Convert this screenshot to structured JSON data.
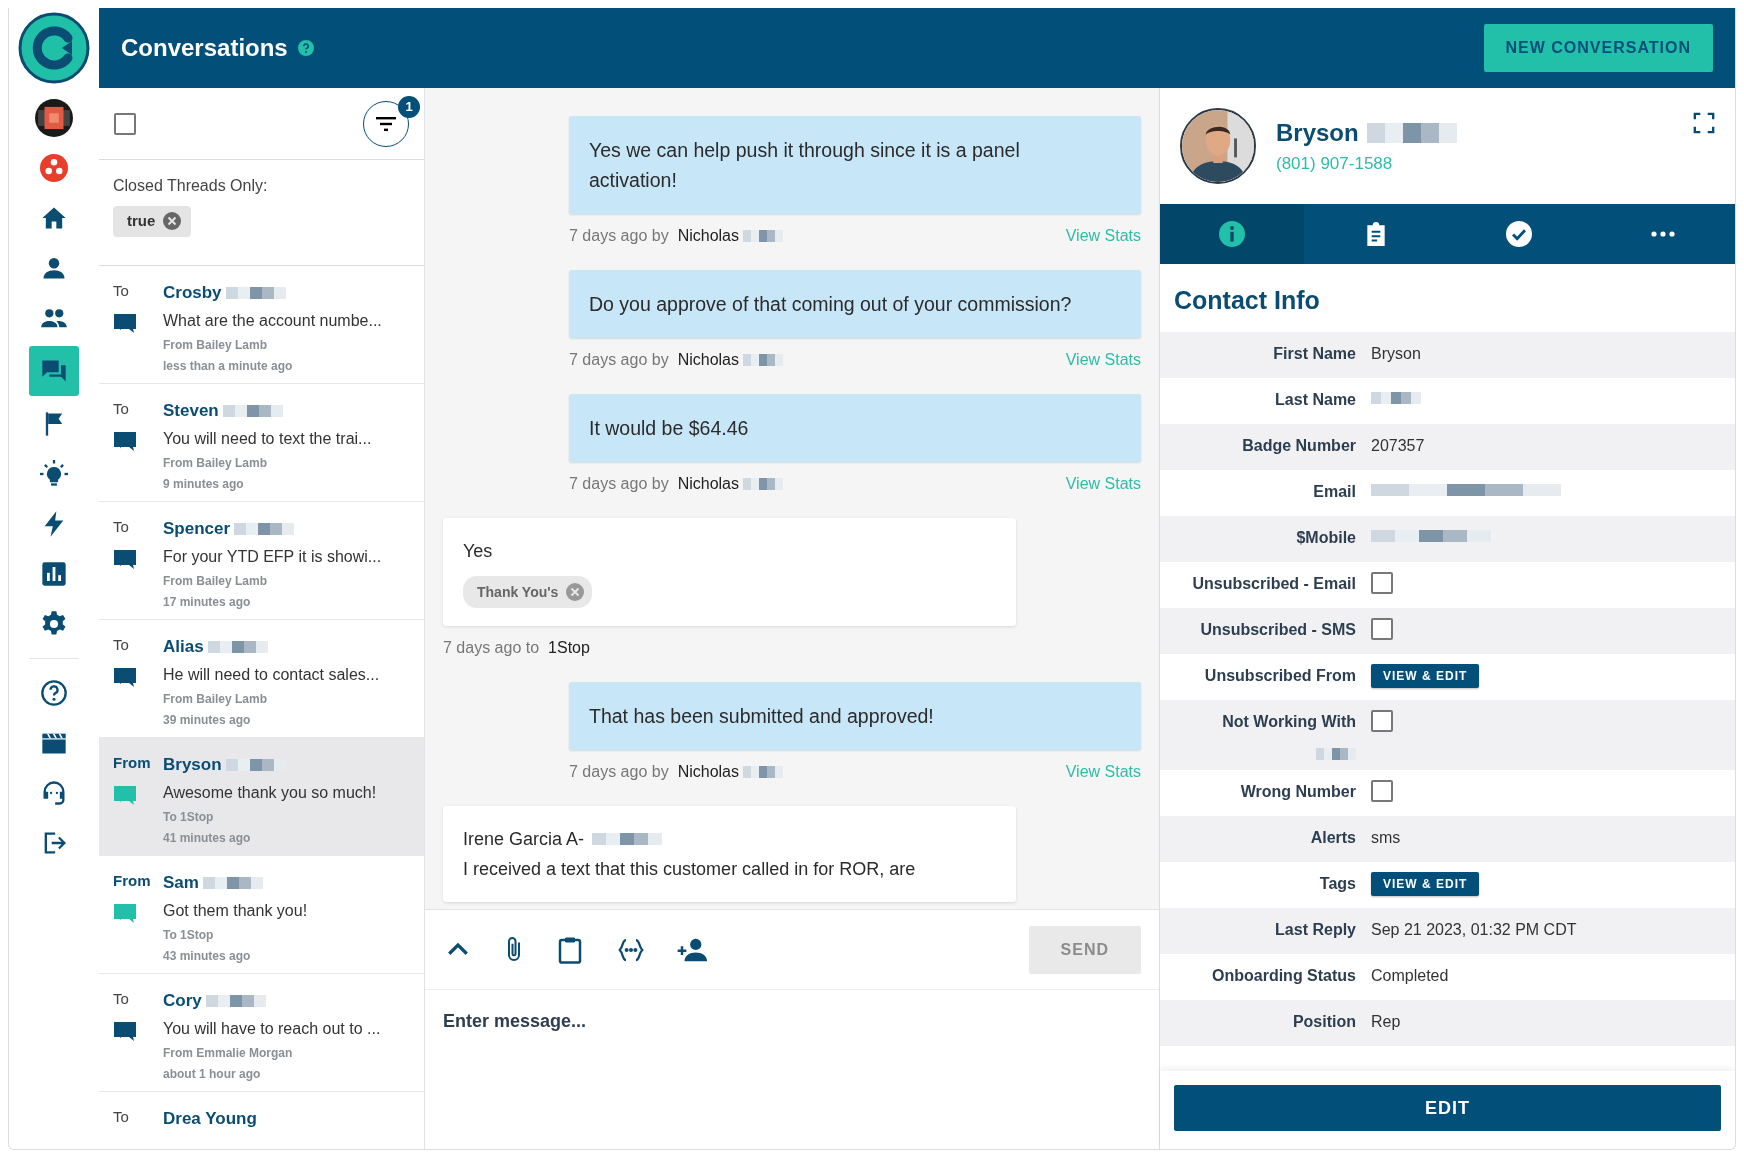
{
  "sidebar": {
    "items": [
      {
        "selected": false
      },
      {
        "selected": false
      },
      {
        "selected": false
      },
      {
        "selected": false
      },
      {
        "selected": false
      },
      {
        "selected": true
      },
      {
        "selected": false
      },
      {
        "selected": false
      },
      {
        "selected": false
      },
      {
        "selected": false
      },
      {
        "selected": false
      },
      {
        "selected": false
      },
      {
        "selected": false
      },
      {
        "selected": false
      },
      {
        "selected": false
      }
    ]
  },
  "header": {
    "title": "Conversations",
    "new_button": "NEW CONVERSATION"
  },
  "thread_list": {
    "select_all": {
      "checked": false
    },
    "filter_count": "1",
    "filter": {
      "label": "Closed Threads Only:",
      "chip": "true"
    },
    "threads": [
      {
        "kind": "outgoing",
        "direction": "To",
        "name": "Crosby",
        "redacted": true,
        "preview": "What are the account numbe...",
        "from_line": "From Bailey Lamb",
        "time": "less than a minute ago",
        "selected": false
      },
      {
        "kind": "outgoing",
        "direction": "To",
        "name": "Steven",
        "redacted": true,
        "preview": "You will need to text the trai...",
        "from_line": "From Bailey Lamb",
        "time": "9 minutes ago",
        "selected": false
      },
      {
        "kind": "outgoing",
        "direction": "To",
        "name": "Spencer",
        "redacted": true,
        "preview": "For your YTD EFP it is showi...",
        "from_line": "From Bailey Lamb",
        "time": "17 minutes ago",
        "selected": false
      },
      {
        "kind": "outgoing",
        "direction": "To",
        "name": "Alias",
        "redacted": true,
        "preview": "He will need to contact sales...",
        "from_line": "From Bailey Lamb",
        "time": "39 minutes ago",
        "selected": false
      },
      {
        "kind": "incoming",
        "direction": "From",
        "name": "Bryson",
        "redacted": true,
        "preview": "Awesome thank you so much!",
        "from_line": "To 1Stop",
        "time": "41 minutes ago",
        "selected": true
      },
      {
        "kind": "incoming",
        "direction": "From",
        "name": "Sam",
        "redacted": true,
        "preview": "Got them thank you!",
        "from_line": "To 1Stop",
        "time": "43 minutes ago",
        "selected": false
      },
      {
        "kind": "outgoing",
        "direction": "To",
        "name": "Cory",
        "redacted": true,
        "preview": "You will have to reach out to ...",
        "from_line": "From Emmalie Morgan",
        "time": "about 1 hour ago",
        "selected": false
      },
      {
        "kind": "outgoing",
        "direction": "To",
        "name": "Drea Young",
        "redacted": false,
        "selected": false
      }
    ]
  },
  "chat": {
    "messages": [
      {
        "kind": "outgoing",
        "text": "Yes we can help push it through since it is a panel activation!",
        "time": "7 days ago by",
        "author": "Nicholas",
        "redacted": true,
        "link": "View Stats"
      },
      {
        "kind": "outgoing",
        "text": "Do you approve of that coming out of your commission?",
        "time": "7 days ago by",
        "author": "Nicholas",
        "redacted": true,
        "link": "View Stats"
      },
      {
        "kind": "outgoing",
        "text": "It would be $64.46",
        "time": "7 days ago by",
        "author": "Nicholas",
        "redacted": true,
        "link": "View Stats"
      },
      {
        "kind": "incoming",
        "text": "Yes",
        "tags": [
          "Thank You's"
        ],
        "time": "7 days ago to",
        "author": "1Stop"
      },
      {
        "kind": "outgoing",
        "text": "That has been submitted and approved!",
        "time": "7 days ago by",
        "author": "Nicholas",
        "redacted": true,
        "link": "View Stats"
      },
      {
        "kind": "incoming",
        "sender": "Irene Garcia A-",
        "sender_redacted": true,
        "text": "I received a text that this customer called in for ROR, are"
      }
    ],
    "composer": {
      "send": "SEND",
      "send_disabled": true,
      "placeholder": "Enter message..."
    }
  },
  "contact": {
    "name": "Bryson",
    "redacted": true,
    "phone": "(801) 907-1588",
    "tabs": [
      {
        "selected": true
      },
      {
        "selected": false
      },
      {
        "selected": false
      },
      {
        "selected": false
      }
    ],
    "heading": "Contact Info",
    "fields": [
      {
        "kind": "text",
        "label": "First Name",
        "value": "Bryson"
      },
      {
        "kind": "text",
        "label": "Last Name",
        "redacted": true
      },
      {
        "kind": "text",
        "label": "Badge Number",
        "value": "207357"
      },
      {
        "kind": "text",
        "label": "Email",
        "redacted": true
      },
      {
        "kind": "text",
        "label": "$Mobile",
        "redacted": true
      },
      {
        "kind": "checkbox",
        "label": "Unsubscribed - Email",
        "checked": false
      },
      {
        "kind": "checkbox",
        "label": "Unsubscribed - SMS",
        "checked": false
      },
      {
        "kind": "button",
        "label": "Unsubscribed From",
        "button": "VIEW & EDIT"
      },
      {
        "kind": "checkbox",
        "label": "Not Working With",
        "label_redacted": true,
        "checked": false
      },
      {
        "kind": "checkbox",
        "label": "Wrong Number",
        "checked": false
      },
      {
        "kind": "text",
        "label": "Alerts",
        "value": "sms"
      },
      {
        "kind": "button",
        "label": "Tags",
        "button": "VIEW & EDIT"
      },
      {
        "kind": "text",
        "label": "Last Reply",
        "value": "Sep 21 2023, 01:32 PM CDT"
      },
      {
        "kind": "text",
        "label": "Onboarding Status",
        "value": "Completed"
      },
      {
        "kind": "text",
        "label": "Position",
        "value": "Rep"
      }
    ],
    "edit": "EDIT"
  }
}
